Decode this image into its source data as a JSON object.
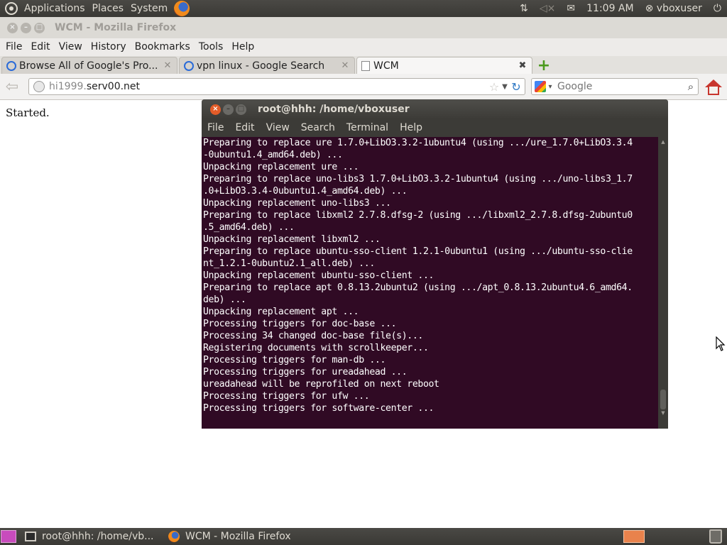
{
  "top_panel": {
    "menus": [
      "Applications",
      "Places",
      "System"
    ],
    "clock": "11:09 AM",
    "user": "vboxuser",
    "icons": [
      "ubuntu-logo-icon",
      "firefox-icon",
      "network-icon",
      "volume-muted-icon",
      "mail-icon",
      "user-switch-icon",
      "power-icon"
    ]
  },
  "firefox": {
    "window_title": "WCM - Mozilla Firefox",
    "menu": [
      "File",
      "Edit",
      "View",
      "History",
      "Bookmarks",
      "Tools",
      "Help"
    ],
    "tabs": [
      {
        "label": "Browse All of Google's Pro...",
        "icon": "google-icon",
        "active": false
      },
      {
        "label": "vpn linux - Google Search",
        "icon": "google-icon",
        "active": false
      },
      {
        "label": "WCM",
        "icon": "blank-page-icon",
        "active": true
      }
    ],
    "url_prefix": "hi1999.",
    "url_domain": "serv00.net",
    "search_placeholder": "Google",
    "page_text": "Started."
  },
  "terminal": {
    "title": "root@hhh: /home/vboxuser",
    "menu": [
      "File",
      "Edit",
      "View",
      "Search",
      "Terminal",
      "Help"
    ],
    "lines": [
      "Preparing to replace ure 1.7.0+LibO3.3.2-1ubuntu4 (using .../ure_1.7.0+LibO3.3.4",
      "-0ubuntu1.4_amd64.deb) ...",
      "Unpacking replacement ure ...",
      "Preparing to replace uno-libs3 1.7.0+LibO3.3.2-1ubuntu4 (using .../uno-libs3_1.7",
      ".0+LibO3.3.4-0ubuntu1.4_amd64.deb) ...",
      "Unpacking replacement uno-libs3 ...",
      "Preparing to replace libxml2 2.7.8.dfsg-2 (using .../libxml2_2.7.8.dfsg-2ubuntu0",
      ".5_amd64.deb) ...",
      "Unpacking replacement libxml2 ...",
      "Preparing to replace ubuntu-sso-client 1.2.1-0ubuntu1 (using .../ubuntu-sso-clie",
      "nt_1.2.1-0ubuntu2.1_all.deb) ...",
      "Unpacking replacement ubuntu-sso-client ...",
      "Preparing to replace apt 0.8.13.2ubuntu2 (using .../apt_0.8.13.2ubuntu4.6_amd64.",
      "deb) ...",
      "Unpacking replacement apt ...",
      "Processing triggers for doc-base ...",
      "Processing 34 changed doc-base file(s)...",
      "Registering documents with scrollkeeper...",
      "Processing triggers for man-db ...",
      "Processing triggers for ureadahead ...",
      "ureadahead will be reprofiled on next reboot",
      "Processing triggers for ufw ...",
      "Processing triggers for software-center ..."
    ]
  },
  "bottom_panel": {
    "tasks": [
      {
        "label": "root@hhh: /home/vb...",
        "icon": "terminal-icon"
      },
      {
        "label": "WCM - Mozilla Firefox",
        "icon": "firefox-icon"
      }
    ]
  }
}
